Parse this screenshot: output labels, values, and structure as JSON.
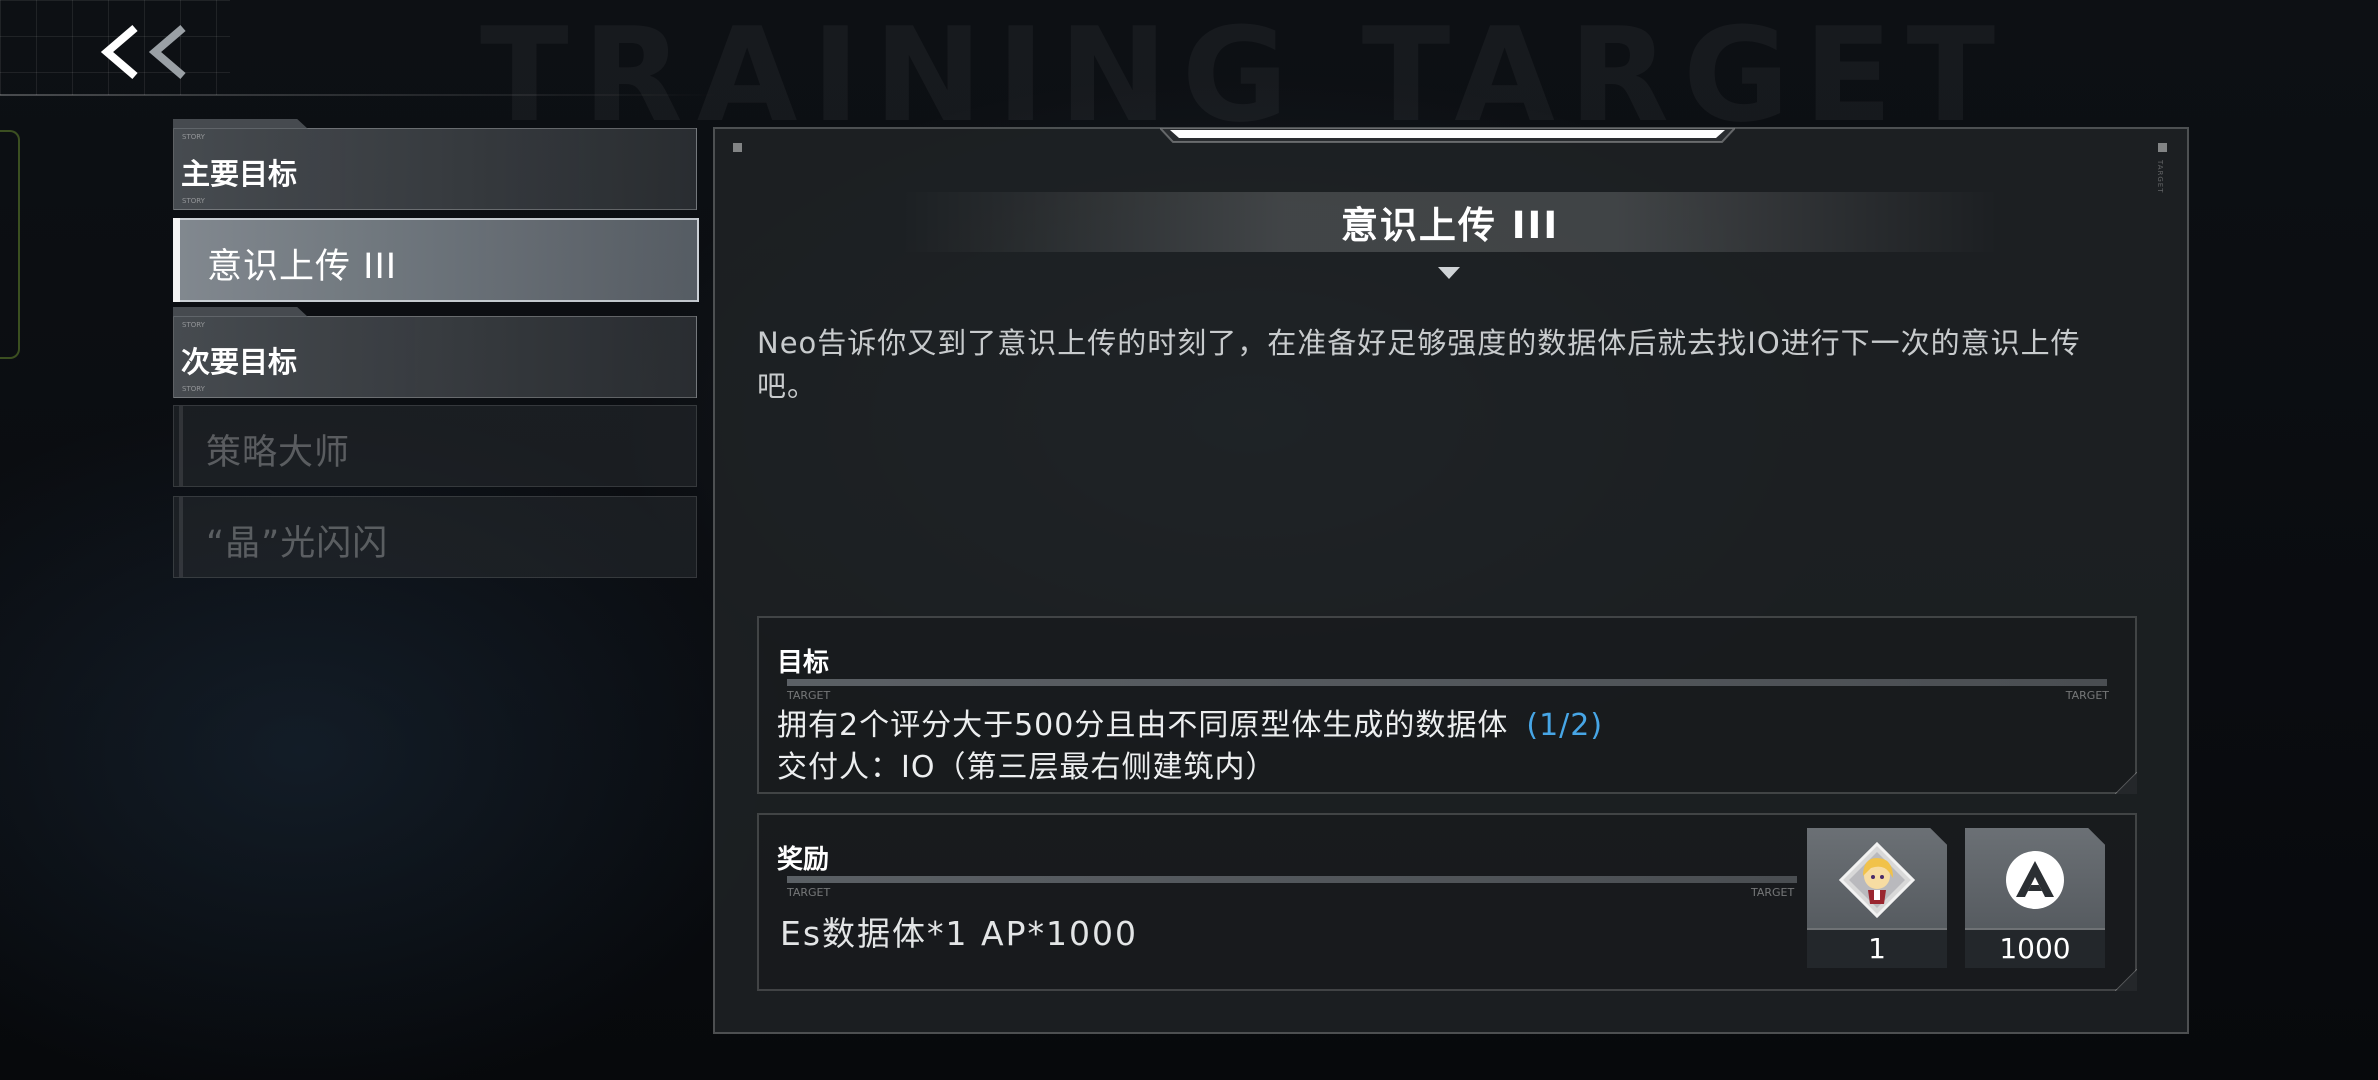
{
  "header": {
    "background_title": "TRAINING TARGET",
    "back_label": "<<"
  },
  "sidebar": {
    "categories": [
      {
        "label": "主要目标"
      },
      {
        "label": "次要目标"
      }
    ],
    "items": [
      {
        "label": "意识上传 III",
        "active": true
      },
      {
        "label": "策略大师",
        "active": false
      },
      {
        "label": "“晶”光闪闪",
        "active": false
      }
    ]
  },
  "mission": {
    "title": "意识上传 III",
    "description": "Neo告诉你又到了意识上传的时刻了，在准备好足够强度的数据体后就去找IO进行下一次的意识上传吧。",
    "goal": {
      "heading": "目标",
      "requirement": "拥有2个评分大于500分且由不同原型体生成的数据体",
      "progress": "(1/2)",
      "deliver_to": "交付人：IO（第三层最右侧建筑内）",
      "bar_label_left": "TARGET",
      "bar_label_right": "TARGET"
    },
    "reward": {
      "heading": "奖励",
      "text": "Es数据体*1  AP*1000",
      "bar_label_left": "TARGET",
      "bar_label_right": "TARGET",
      "items": [
        {
          "icon": "character-chibi-icon",
          "count": "1"
        },
        {
          "icon": "ap-currency-icon",
          "count": "1000"
        }
      ]
    }
  },
  "colors": {
    "progress": "#47a6e6",
    "panel": "#202326",
    "active_item": "#8d959c"
  }
}
